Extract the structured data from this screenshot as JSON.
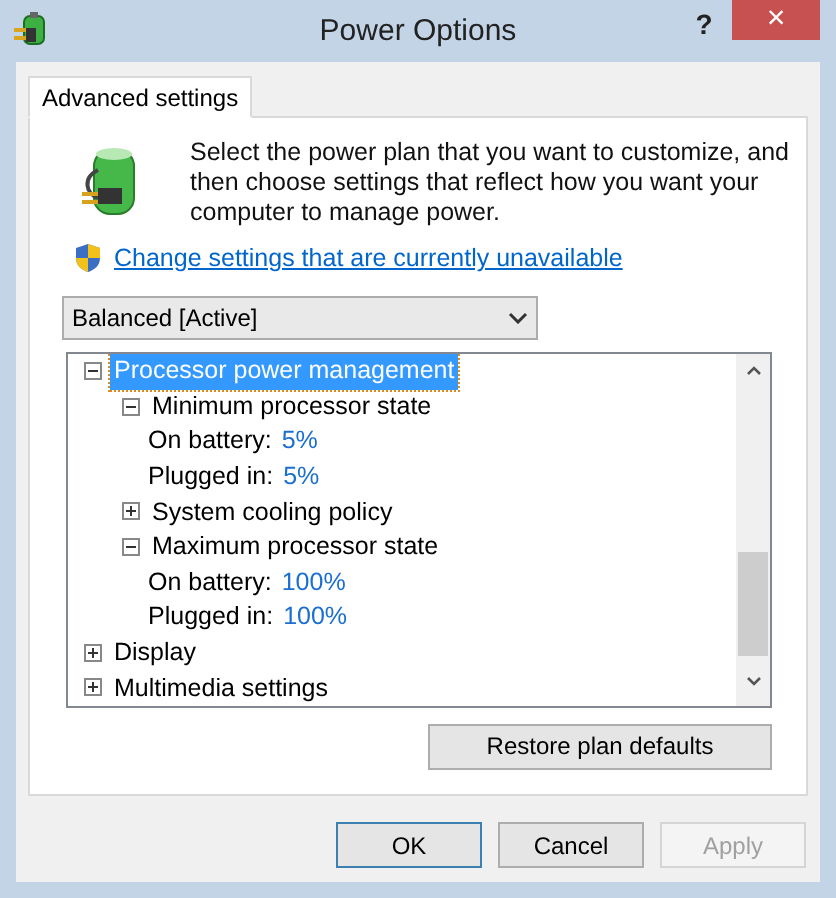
{
  "window": {
    "title": "Power Options",
    "help": "?",
    "close": "×"
  },
  "tabs": [
    {
      "label": "Advanced settings",
      "selected": true
    }
  ],
  "description": "Select the power plan that you want to customize, and then choose settings that reflect how you want your computer to manage power.",
  "link": "Change settings that are currently unavailable",
  "plan_dropdown": {
    "value": "Balanced [Active]"
  },
  "tree": [
    {
      "label": "Processor power management",
      "expanded": true,
      "selected": true,
      "children": [
        {
          "label": "Minimum processor state",
          "expanded": true,
          "selected": false,
          "children": [
            {
              "label": "On battery:",
              "value": "5%"
            },
            {
              "label": "Plugged in:",
              "value": "5%"
            }
          ]
        },
        {
          "label": "System cooling policy",
          "expanded": false,
          "selected": false
        },
        {
          "label": "Maximum processor state",
          "expanded": true,
          "selected": false,
          "children": [
            {
              "label": "On battery:",
              "value": "100%"
            },
            {
              "label": "Plugged in:",
              "value": "100%"
            }
          ]
        }
      ]
    },
    {
      "label": "Display",
      "expanded": false,
      "selected": false
    },
    {
      "label": "Multimedia settings",
      "expanded": false,
      "selected": false
    }
  ],
  "restore_button": "Restore plan defaults",
  "buttons": [
    {
      "label": "OK",
      "disabled": false,
      "default": true
    },
    {
      "label": "Cancel",
      "disabled": false,
      "default": false
    },
    {
      "label": "Apply",
      "disabled": true,
      "default": false
    }
  ]
}
